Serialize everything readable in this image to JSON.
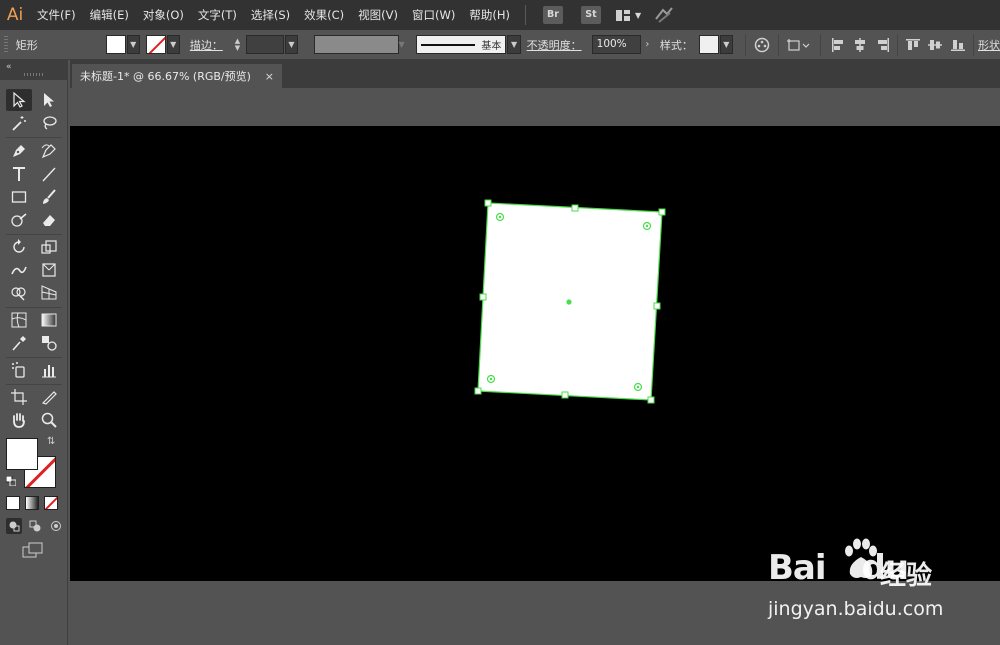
{
  "app": {
    "logo": "Ai"
  },
  "menu": {
    "items": [
      "文件(F)",
      "编辑(E)",
      "对象(O)",
      "文字(T)",
      "选择(S)",
      "效果(C)",
      "视图(V)",
      "窗口(W)",
      "帮助(H)"
    ],
    "bridge": "Br",
    "stock": "St"
  },
  "control": {
    "selection_label": "矩形",
    "stroke_label": "描边：",
    "stroke_style": "基本",
    "opacity_label": "不透明度：",
    "opacity_value": "100%",
    "style_label": "样式：",
    "shape_label": "形状"
  },
  "document": {
    "tab_title": "未标题-1* @ 66.67% (RGB/预览)",
    "close_glyph": "×"
  },
  "tools": {
    "icons": [
      "selection-icon",
      "direct-selection-icon",
      "magic-wand-icon",
      "lasso-icon",
      "pen-icon",
      "curvature-icon",
      "type-icon",
      "line-icon",
      "rectangle-icon",
      "paintbrush-icon",
      "shaper-icon",
      "eraser-icon",
      "rotate-icon",
      "scale-icon",
      "warp-icon",
      "free-transform-icon",
      "shape-builder-icon",
      "perspective-icon",
      "mesh-icon",
      "gradient-icon",
      "eyedropper-icon",
      "blend-icon",
      "symbol-sprayer-icon",
      "graph-icon",
      "artboard-icon",
      "slice-icon",
      "hand-icon",
      "zoom-icon"
    ]
  },
  "colors": {
    "selection": "#4ade4a",
    "canvas": "#000000",
    "shape_fill": "#ffffff",
    "none_slash": "#e02020",
    "app_logo": "#f0a052"
  },
  "watermark": {
    "brand": "Bai",
    "brand_suffix": "du",
    "cn": "经验",
    "url": "jingyan.baidu.com"
  }
}
